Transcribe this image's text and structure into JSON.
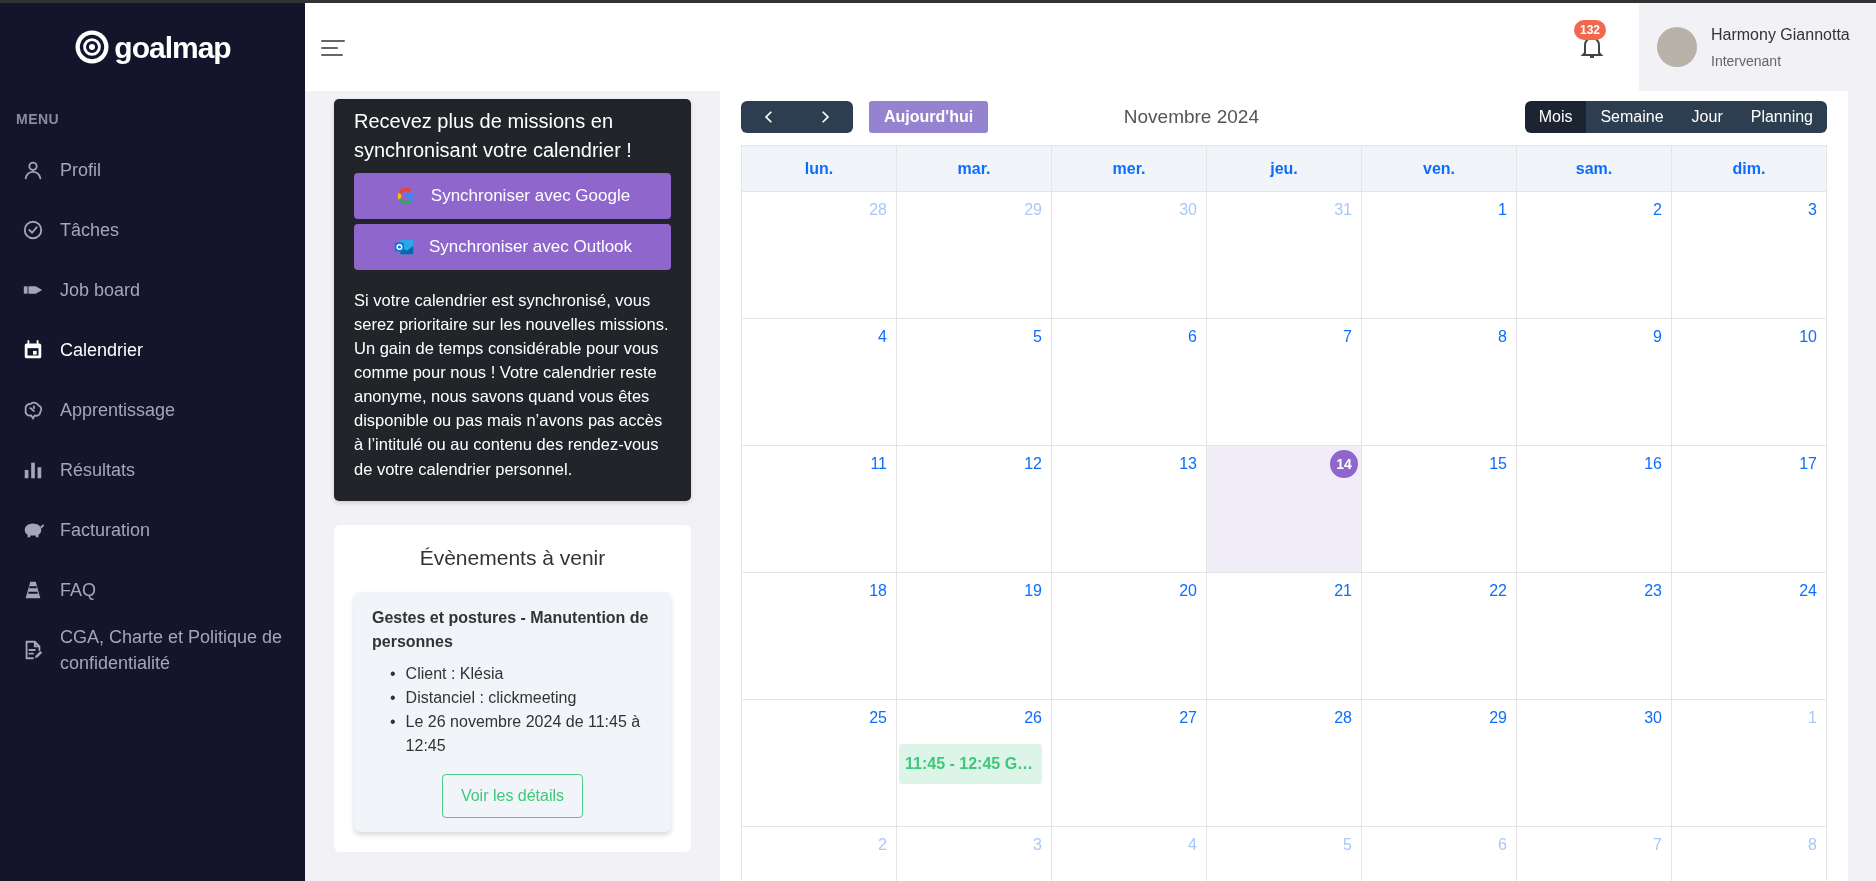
{
  "sidebar": {
    "logo": "goalmap",
    "menu_label": "MENU",
    "items": [
      {
        "label": "Profil",
        "selected": false
      },
      {
        "label": "Tâches",
        "selected": false
      },
      {
        "label": "Job board",
        "selected": false
      },
      {
        "label": "Calendrier",
        "selected": true
      },
      {
        "label": "Apprentissage",
        "selected": false
      },
      {
        "label": "Résultats",
        "selected": false
      },
      {
        "label": "Facturation",
        "selected": false
      },
      {
        "label": "FAQ",
        "selected": false
      },
      {
        "label": "CGA, Charte et Politique de confidentialité",
        "selected": false
      }
    ]
  },
  "header": {
    "notification_count": "132",
    "user": {
      "name": "Harmony Giannotta",
      "role": "Intervenant"
    }
  },
  "sync_card": {
    "title": "Recevez plus de missions en synchronisant votre calendrier !",
    "buttons": [
      {
        "label": "Synchroniser avec Google",
        "kind": "google"
      },
      {
        "label": "Synchroniser avec Outlook",
        "kind": "outlook"
      }
    ],
    "text": "Si votre calendrier est synchronisé, vous serez prioritaire sur les nouvelles missions. Un gain de temps considérable pour vous comme pour nous ! Votre calendrier reste anonyme, nous savons quand vous êtes disponible ou pas mais n’avons pas accès à l’intitulé ou au contenu des rendez-vous de votre calendrier personnel."
  },
  "upcoming": {
    "title": "Évènements à venir",
    "events": [
      {
        "title": "Gestes et postures - Manutention de personnes",
        "bullet": "•",
        "details": [
          "Client : Klésia",
          "Distanciel : clickmeeting",
          "Le 26 novembre 2024 de 11:45 à 12:45"
        ],
        "button": "Voir les détails"
      }
    ]
  },
  "calendar": {
    "today_button": "Aujourd'hui",
    "month": "Novembre 2024",
    "views": [
      {
        "label": "Mois",
        "selected": true
      },
      {
        "label": "Semaine",
        "selected": false
      },
      {
        "label": "Jour",
        "selected": false
      },
      {
        "label": "Planning",
        "selected": false
      }
    ],
    "weekdays": [
      "lun.",
      "mar.",
      "mer.",
      "jeu.",
      "ven.",
      "sam.",
      "dim."
    ],
    "weeks": [
      [
        {
          "day": "28",
          "outside": true,
          "today": false
        },
        {
          "day": "29",
          "outside": true,
          "today": false
        },
        {
          "day": "30",
          "outside": true,
          "today": false
        },
        {
          "day": "31",
          "outside": true,
          "today": false
        },
        {
          "day": "1",
          "outside": false,
          "today": false
        },
        {
          "day": "2",
          "outside": false,
          "today": false
        },
        {
          "day": "3",
          "outside": false,
          "today": false
        }
      ],
      [
        {
          "day": "4",
          "outside": false,
          "today": false
        },
        {
          "day": "5",
          "outside": false,
          "today": false
        },
        {
          "day": "6",
          "outside": false,
          "today": false
        },
        {
          "day": "7",
          "outside": false,
          "today": false
        },
        {
          "day": "8",
          "outside": false,
          "today": false
        },
        {
          "day": "9",
          "outside": false,
          "today": false
        },
        {
          "day": "10",
          "outside": false,
          "today": false
        }
      ],
      [
        {
          "day": "11",
          "outside": false,
          "today": false
        },
        {
          "day": "12",
          "outside": false,
          "today": false
        },
        {
          "day": "13",
          "outside": false,
          "today": false
        },
        {
          "day": "14",
          "outside": false,
          "today": true
        },
        {
          "day": "15",
          "outside": false,
          "today": false
        },
        {
          "day": "16",
          "outside": false,
          "today": false
        },
        {
          "day": "17",
          "outside": false,
          "today": false
        }
      ],
      [
        {
          "day": "18",
          "outside": false,
          "today": false
        },
        {
          "day": "19",
          "outside": false,
          "today": false
        },
        {
          "day": "20",
          "outside": false,
          "today": false
        },
        {
          "day": "21",
          "outside": false,
          "today": false
        },
        {
          "day": "22",
          "outside": false,
          "today": false
        },
        {
          "day": "23",
          "outside": false,
          "today": false
        },
        {
          "day": "24",
          "outside": false,
          "today": false
        }
      ],
      [
        {
          "day": "25",
          "outside": false,
          "today": false
        },
        {
          "day": "26",
          "outside": false,
          "today": false,
          "events": [
            "11:45 - 12:45 G…"
          ]
        },
        {
          "day": "27",
          "outside": false,
          "today": false
        },
        {
          "day": "28",
          "outside": false,
          "today": false
        },
        {
          "day": "29",
          "outside": false,
          "today": false
        },
        {
          "day": "30",
          "outside": false,
          "today": false
        },
        {
          "day": "1",
          "outside": true,
          "today": false
        }
      ],
      [
        {
          "day": "2",
          "outside": true,
          "today": false
        },
        {
          "day": "3",
          "outside": true,
          "today": false
        },
        {
          "day": "4",
          "outside": true,
          "today": false
        },
        {
          "day": "5",
          "outside": true,
          "today": false
        },
        {
          "day": "6",
          "outside": true,
          "today": false
        },
        {
          "day": "7",
          "outside": true,
          "today": false
        },
        {
          "day": "8",
          "outside": true,
          "today": false
        }
      ]
    ]
  }
}
